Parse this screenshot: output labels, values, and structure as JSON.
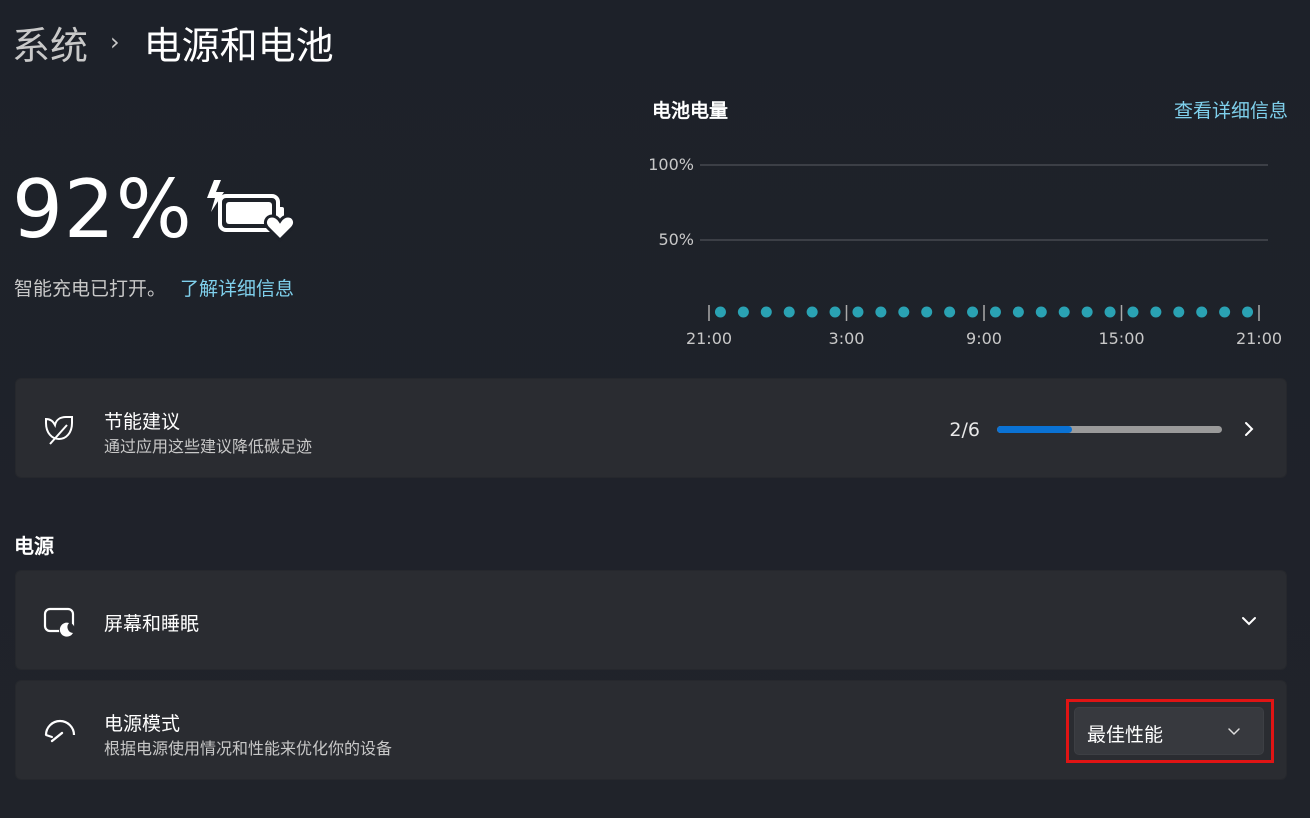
{
  "breadcrumb": {
    "parent": "系统",
    "separator": "›",
    "current": "电源和电池"
  },
  "battery": {
    "percent_label": "92%",
    "smart_charging_status": "智能充电已打开。",
    "learn_more_link": "了解详细信息"
  },
  "battery_chart": {
    "title": "电池电量",
    "details_link": "查看详细信息"
  },
  "chart_data": {
    "type": "scatter",
    "title": "电池电量",
    "y_ticks": [
      "100%",
      "50%"
    ],
    "x_ticks": [
      "21:00",
      "3:00",
      "9:00",
      "15:00",
      "21:00"
    ],
    "x_tick_hours": [
      0,
      6,
      12,
      18,
      24
    ],
    "ylim": [
      0,
      100
    ],
    "grid": true,
    "series": [
      {
        "color": "#2aa2b3",
        "x_hours": [
          0.5,
          1.5,
          2.5,
          3.5,
          4.5,
          5.5,
          6.5,
          7.5,
          8.5,
          9.5,
          10.5,
          11.5,
          12.5,
          13.5,
          14.5,
          15.5,
          16.5,
          17.5,
          18.5,
          19.5,
          20.5,
          21.5,
          22.5,
          23.5
        ],
        "values": [
          2,
          2,
          2,
          2,
          2,
          2,
          2,
          2,
          2,
          2,
          2,
          2,
          2,
          2,
          2,
          2,
          2,
          2,
          2,
          2,
          2,
          2,
          2,
          2
        ]
      }
    ]
  },
  "energy_recommendations": {
    "title": "节能建议",
    "subtitle": "通过应用这些建议降低碳足迹",
    "progress_text": "2/6",
    "progress_fraction": 0.333
  },
  "power_section": {
    "title": "电源",
    "screen_sleep": {
      "title": "屏幕和睡眠"
    },
    "power_mode": {
      "title": "电源模式",
      "subtitle": "根据电源使用情况和性能来优化你的设备",
      "selected_value": "最佳性能"
    }
  },
  "colors": {
    "accent_link": "#7fd0ec",
    "progress_fill": "#0a72d4",
    "chart_dots": "#2aa2b3",
    "highlight": "#e01414"
  },
  "icons": [
    "chevron-right-icon",
    "battery-charging-heart-icon",
    "leaf-icon",
    "screen-sleep-icon",
    "speedometer-icon",
    "chevron-down-icon"
  ]
}
